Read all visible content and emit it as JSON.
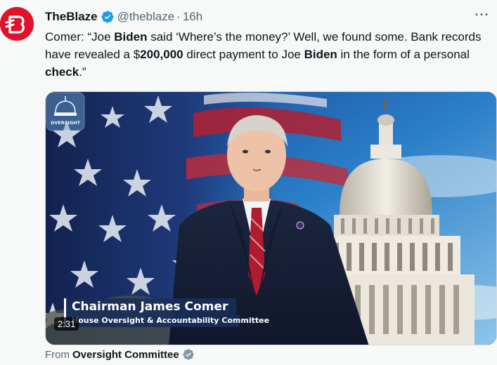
{
  "tweet": {
    "author_name": "TheBlaze",
    "handle": "@theblaze",
    "separator": "·",
    "time": "16h",
    "more_label": "···",
    "text_parts": [
      {
        "t": "Comer: “Joe ",
        "b": false
      },
      {
        "t": "Biden",
        "b": true
      },
      {
        "t": " said ‘Where’s the money?’ Well, we found some. Bank records have revealed a $",
        "b": false
      },
      {
        "t": "200,000",
        "b": true
      },
      {
        "t": " direct payment to Joe ",
        "b": false
      },
      {
        "t": "Biden",
        "b": true
      },
      {
        "t": " in the form of a personal ",
        "b": false
      },
      {
        "t": "check",
        "b": true
      },
      {
        "t": ".”",
        "b": false
      }
    ]
  },
  "video": {
    "lower_third_name": "Chairman James Comer",
    "lower_third_subtitle": "House Oversight & Accountability Committee",
    "duration": "2:31",
    "badge_text": "OVERSIGHT"
  },
  "attribution": {
    "prefix": "From",
    "source": "Oversight Committee"
  },
  "colors": {
    "brand_red": "#e0112b",
    "verified_blue": "#1d9bf0",
    "text_secondary": "#536471"
  },
  "icons": {
    "avatar": "blaze-logo-icon",
    "verified": "verified-badge-icon",
    "more": "more-horizontal-icon",
    "source_verified": "gray-verified-badge-icon"
  }
}
